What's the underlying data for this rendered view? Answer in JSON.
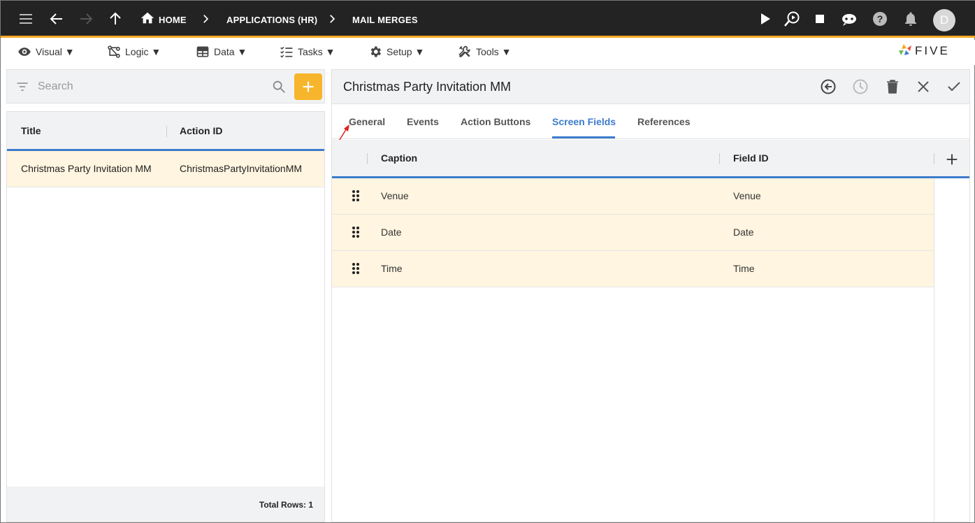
{
  "topbar": {
    "breadcrumbs": [
      "HOME",
      "APPLICATIONS (HR)",
      "MAIL MERGES"
    ],
    "avatar_letter": "D",
    "icons": [
      "menu-icon",
      "back-arrow-icon",
      "forward-arrow-icon",
      "up-arrow-icon",
      "home-icon",
      "play-icon",
      "run-search-icon",
      "stop-icon",
      "chat-bot-icon",
      "help-icon",
      "bell-icon"
    ]
  },
  "menubar": {
    "items": [
      {
        "label": "Visual ▼",
        "icon": "eye-icon"
      },
      {
        "label": "Logic ▼",
        "icon": "logic-icon"
      },
      {
        "label": "Data ▼",
        "icon": "table-icon"
      },
      {
        "label": "Tasks ▼",
        "icon": "checklist-icon"
      },
      {
        "label": "Setup ▼",
        "icon": "gear-icon"
      },
      {
        "label": "Tools ▼",
        "icon": "tools-icon"
      }
    ],
    "logo_text": "FIVE"
  },
  "left": {
    "search_placeholder": "Search",
    "columns": [
      "Title",
      "Action ID"
    ],
    "rows": [
      {
        "title": "Christmas Party Invitation MM",
        "action_id": "ChristmasPartyInvitationMM"
      }
    ],
    "total_rows": "Total Rows: 1"
  },
  "form": {
    "title": "Christmas Party Invitation MM",
    "tabs": [
      "General",
      "Events",
      "Action Buttons",
      "Screen Fields",
      "References"
    ],
    "active_tab": "Screen Fields",
    "columns": [
      "Caption",
      "Field ID"
    ],
    "rows": [
      {
        "caption": "Venue",
        "field_id": "Venue"
      },
      {
        "caption": "Date",
        "field_id": "Date"
      },
      {
        "caption": "Time",
        "field_id": "Time"
      }
    ]
  },
  "colors": {
    "accent": "#3c7ccc",
    "orange": "#f7b52b",
    "row_highlight": "#fff5e0",
    "topbar": "#232323"
  }
}
